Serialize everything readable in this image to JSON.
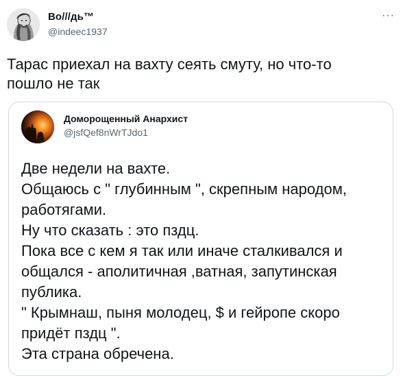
{
  "tweet": {
    "author_name": "Во///дь™",
    "author_handle": "@indeec1937",
    "more_icon": "more-horizontal-icon",
    "text_lines": [
      "Тарас приехал на вахту сеять смуту, но что-то",
      "пошло не так"
    ]
  },
  "quote": {
    "author_name": "Доморощенный Анархист",
    "author_handle": "@jsfQef8nWrTJdo1",
    "text_lines": [
      "Две недели на вахте.",
      "Общаюсь с \" глубинным \", скрепным народом,",
      "работягами.",
      "Ну что сказать : это пздц.",
      "Пока все с кем я так или иначе сталкивался и",
      "общался - аполитичная ,ватная, запутинская",
      "публика.",
      "\" Крымнаш, пыня молодец, $ и гейропе скоро",
      "придёт пздц \".",
      "Эта страна обречена."
    ]
  },
  "colors": {
    "text": "#0f1419",
    "secondary": "#536471",
    "border": "#cfd9de"
  }
}
